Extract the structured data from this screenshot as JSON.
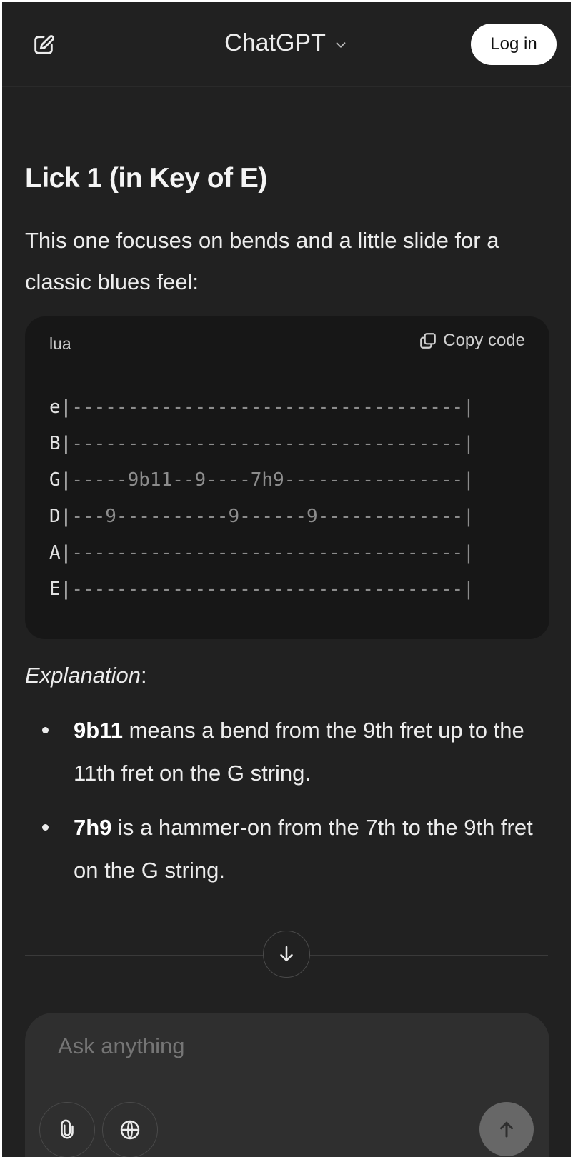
{
  "header": {
    "title": "ChatGPT",
    "login_label": "Log in"
  },
  "icons": {
    "new_chat": "new-chat-icon",
    "chevron": "chevron-down-icon",
    "copy": "copy-icon",
    "scroll_down": "arrow-down-icon",
    "attach": "paperclip-icon",
    "search": "globe-icon",
    "send": "arrow-up-icon"
  },
  "message": {
    "heading": "Lick 1 (in Key of E)",
    "intro": "This one focuses on bends and a little slide for a classic blues feel:",
    "code": {
      "language": "lua",
      "copy_label": "Copy code",
      "lines": [
        "e|-----------------------------------|",
        "B|-----------------------------------|",
        "G|-----9b11--9----7h9----------------|",
        "D|---9----------9------9-------------|",
        "A|-----------------------------------|",
        "E|-----------------------------------|"
      ]
    },
    "explanation_label": "Explanation",
    "explanation_suffix": ":",
    "bullets": [
      {
        "term": "9b11",
        "text": " means a bend from the 9th fret up to the 11th fret on the G string."
      },
      {
        "term": "7h9",
        "text": " is a hammer-on from the 7th to the 9th fret on the G string."
      }
    ]
  },
  "composer": {
    "placeholder": "Ask anything"
  },
  "colors": {
    "background": "#212121",
    "code_background": "#171717",
    "composer_background": "#2f2f2f",
    "text": "#ececec"
  }
}
